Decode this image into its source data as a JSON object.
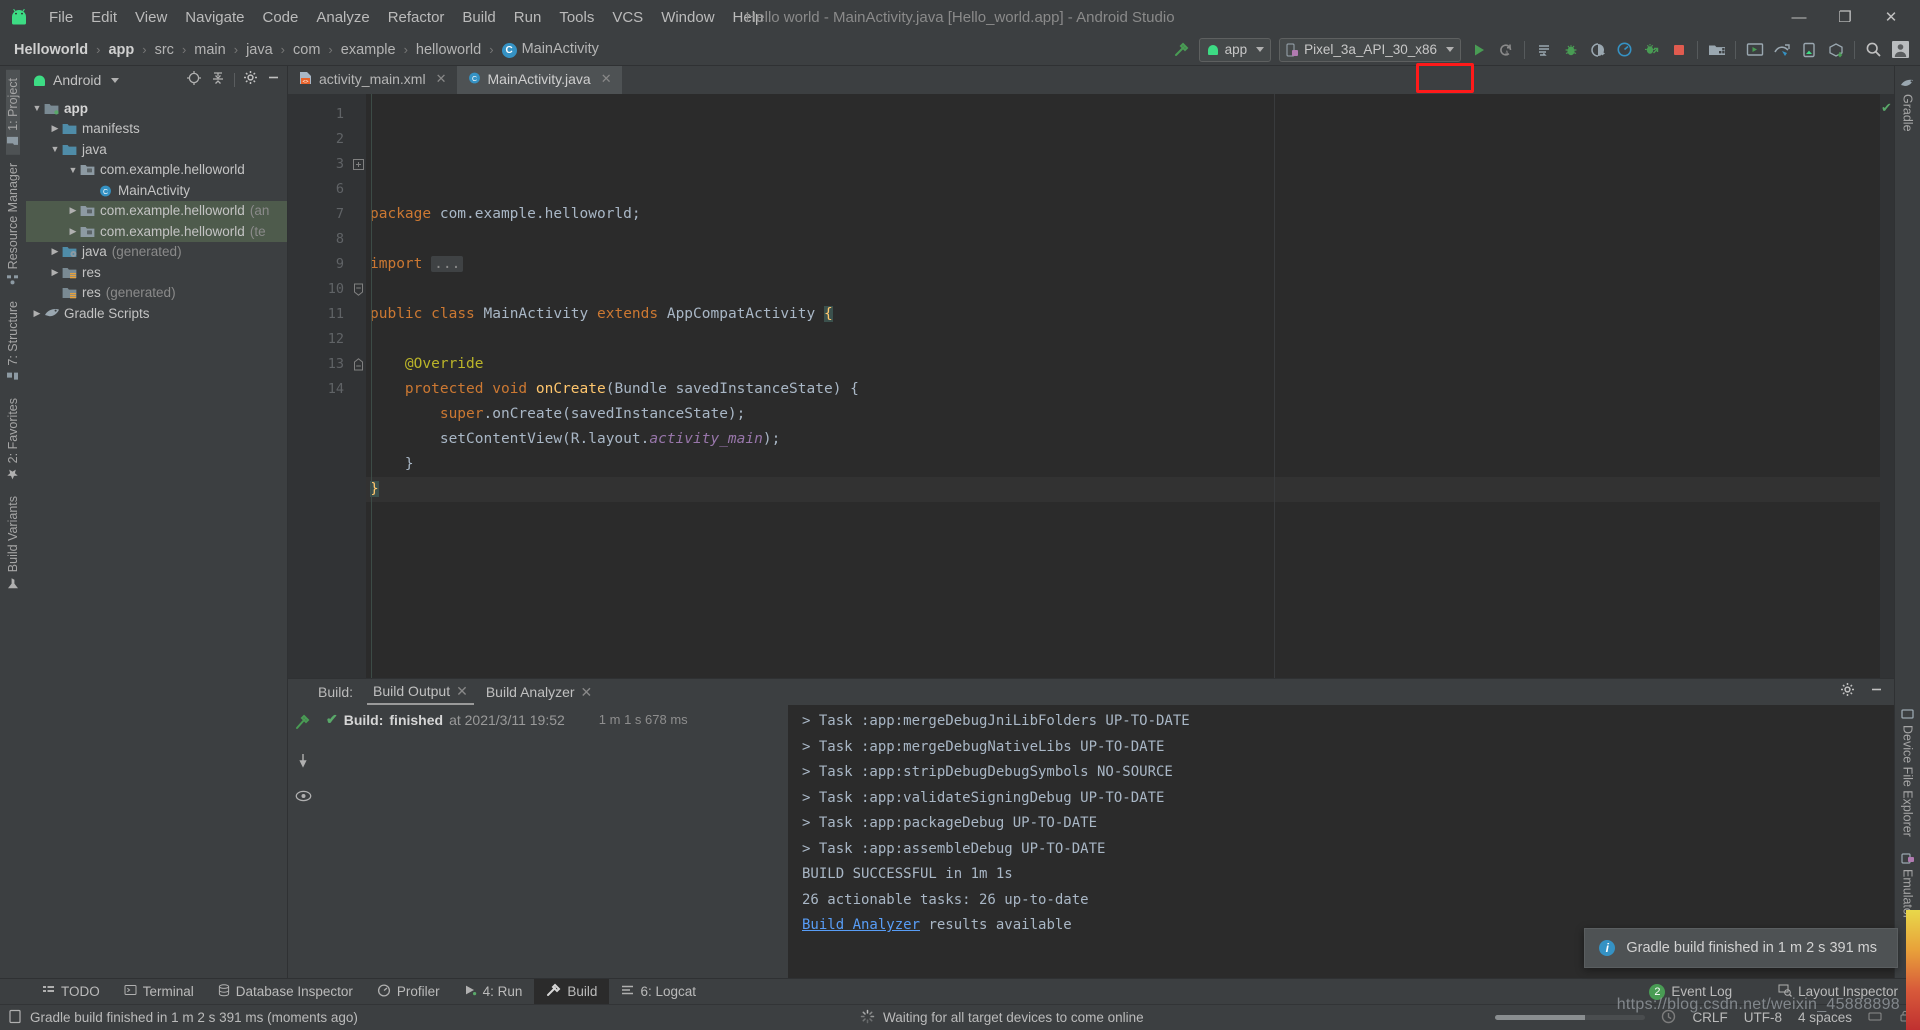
{
  "window": {
    "title": "Hello world - MainActivity.java [Hello_world.app] - Android Studio",
    "minimize": "—",
    "maximize": "❐",
    "close": "✕"
  },
  "menubar": {
    "items": [
      {
        "label": "File"
      },
      {
        "label": "Edit"
      },
      {
        "label": "View"
      },
      {
        "label": "Navigate"
      },
      {
        "label": "Code"
      },
      {
        "label": "Analyze"
      },
      {
        "label": "Refactor"
      },
      {
        "label": "Build"
      },
      {
        "label": "Run"
      },
      {
        "label": "Tools"
      },
      {
        "label": "VCS"
      },
      {
        "label": "Window"
      },
      {
        "label": "Help"
      }
    ]
  },
  "breadcrumb": {
    "items": [
      "Helloworld",
      "app",
      "src",
      "main",
      "java",
      "com",
      "example",
      "helloworld"
    ],
    "final": "MainActivity",
    "final_icon": "C",
    "separator": "›"
  },
  "toolbar": {
    "module_selector": "app",
    "device_selector": "Pixel_3a_API_30_x86",
    "buttons": [
      {
        "name": "make-project",
        "title": "Make Project"
      },
      {
        "name": "run",
        "title": "Run 'app'"
      },
      {
        "name": "apply-changes",
        "title": "Apply Changes"
      },
      {
        "name": "run-with-coverage",
        "title": "Run with Coverage"
      },
      {
        "name": "debug",
        "title": "Debug 'app'"
      },
      {
        "name": "attach-debugger",
        "title": "Attach Debugger to Android Process"
      },
      {
        "name": "profiler",
        "title": "Profile 'app'"
      },
      {
        "name": "debug-apk",
        "title": "Debug APK"
      },
      {
        "name": "stop",
        "title": "Stop"
      },
      {
        "name": "sdk-manager",
        "title": "SDK Manager"
      },
      {
        "name": "avd-manager",
        "title": "AVD Manager"
      },
      {
        "name": "layout-inspector",
        "title": "Layout Inspector"
      },
      {
        "name": "device-manager",
        "title": "Device Manager"
      },
      {
        "name": "sync-gradle",
        "title": "Sync Project with Gradle Files"
      },
      {
        "name": "search-everywhere",
        "title": "Search Everywhere"
      },
      {
        "name": "account",
        "title": "Account"
      }
    ]
  },
  "left_strip": {
    "items": [
      {
        "label": "1: Project",
        "active": true
      },
      {
        "label": "Resource Manager",
        "active": false
      },
      {
        "label": "7: Structure",
        "active": false
      },
      {
        "label": "2: Favorites",
        "active": false
      },
      {
        "label": "Build Variants",
        "active": false
      }
    ]
  },
  "right_strip": {
    "items": [
      {
        "label": "Gradle"
      },
      {
        "label": "Device File Explorer"
      },
      {
        "label": "Emulator"
      }
    ]
  },
  "project_panel": {
    "view_selector": "Android",
    "tree": [
      {
        "indent": 0,
        "arrow": "▼",
        "label": "app",
        "icon": "module-folder",
        "bold": true,
        "dim": "",
        "selected": false
      },
      {
        "indent": 1,
        "arrow": "▶",
        "label": "manifests",
        "icon": "folder",
        "bold": false,
        "dim": "",
        "selected": false
      },
      {
        "indent": 1,
        "arrow": "▼",
        "label": "java",
        "icon": "folder",
        "bold": false,
        "dim": "",
        "selected": false
      },
      {
        "indent": 2,
        "arrow": "▼",
        "label": "com.example.helloworld",
        "icon": "package",
        "bold": false,
        "dim": "",
        "selected": false
      },
      {
        "indent": 3,
        "arrow": "",
        "label": "MainActivity",
        "icon": "class",
        "bold": false,
        "dim": "",
        "selected": false
      },
      {
        "indent": 2,
        "arrow": "▶",
        "label": "com.example.helloworld",
        "icon": "package",
        "bold": false,
        "dim": "(an",
        "selected": true
      },
      {
        "indent": 2,
        "arrow": "▶",
        "label": "com.example.helloworld",
        "icon": "package",
        "bold": false,
        "dim": "(te",
        "selected": true
      },
      {
        "indent": 1,
        "arrow": "▶",
        "label": "java",
        "icon": "folder-gen",
        "bold": false,
        "dim": "(generated)",
        "selected": false
      },
      {
        "indent": 1,
        "arrow": "▶",
        "label": "res",
        "icon": "folder-res",
        "bold": false,
        "dim": "",
        "selected": false
      },
      {
        "indent": 1,
        "arrow": "",
        "label": "res",
        "icon": "folder-res",
        "bold": false,
        "dim": "(generated)",
        "selected": false
      },
      {
        "indent": 0,
        "arrow": "▶",
        "label": "Gradle Scripts",
        "icon": "gradle",
        "bold": false,
        "dim": "",
        "selected": false
      }
    ]
  },
  "editor": {
    "tabs": [
      {
        "label": "activity_main.xml",
        "icon": "xml-layout-icon",
        "active": false,
        "close": "✕"
      },
      {
        "label": "MainActivity.java",
        "icon": "java-class-icon",
        "active": true,
        "close": "✕"
      }
    ],
    "line_numbers": [
      "1",
      "2",
      "3",
      "6",
      "7",
      "8",
      "9",
      "10",
      "11",
      "12",
      "13",
      "14"
    ],
    "lines": [
      "package com.example.helloworld;",
      "",
      "import ...",
      "",
      "public class MainActivity extends AppCompatActivity {",
      "",
      "    @Override",
      "    protected void onCreate(Bundle savedInstanceState) {",
      "        super.onCreate(savedInstanceState);",
      "        setContentView(R.layout.activity_main);",
      "    }",
      "}"
    ]
  },
  "build_panel": {
    "group_label": "Build:",
    "tabs": [
      {
        "label": "Build Output",
        "active": true,
        "close": "✕"
      },
      {
        "label": "Build Analyzer",
        "active": false,
        "close": "✕"
      }
    ],
    "tree_status_prefix": "Build:",
    "tree_status_bold": "finished",
    "tree_status_at": "at 2021/3/11 19:52",
    "tree_duration": "1 m 1 s 678 ms",
    "console": [
      "> Task :app:mergeDebugJniLibFolders UP-TO-DATE",
      "> Task :app:mergeDebugNativeLibs UP-TO-DATE",
      "> Task :app:stripDebugDebugSymbols NO-SOURCE",
      "> Task :app:validateSigningDebug UP-TO-DATE",
      "> Task :app:packageDebug UP-TO-DATE",
      "> Task :app:assembleDebug UP-TO-DATE",
      "",
      "BUILD SUCCESSFUL in 1m 1s",
      "26 actionable tasks: 26 up-to-date",
      ""
    ],
    "console_link": "Build Analyzer",
    "console_link_suffix": " results available"
  },
  "tool_windows": {
    "left": [
      {
        "label": "TODO",
        "icon": "todo-icon",
        "active": false
      },
      {
        "label": "Terminal",
        "icon": "terminal-icon",
        "active": false
      },
      {
        "label": "Database Inspector",
        "icon": "database-icon",
        "active": false
      },
      {
        "label": "Profiler",
        "icon": "profiler-icon",
        "active": false
      },
      {
        "label": "4: Run",
        "icon": "run-icon",
        "active": false
      },
      {
        "label": "Build",
        "icon": "build-hammer-icon",
        "active": true
      },
      {
        "label": "6: Logcat",
        "icon": "logcat-icon",
        "active": false
      }
    ],
    "right": [
      {
        "label": "Event Log",
        "icon": "event-log-icon",
        "badge": "2"
      },
      {
        "label": "Layout Inspector",
        "icon": "layout-inspector-icon",
        "badge": ""
      }
    ]
  },
  "status_bar": {
    "message": "Gradle build finished in 1 m 2 s 391 ms (moments ago)",
    "progress_message": "Waiting for all target devices to come online",
    "line_ending": "CRLF",
    "encoding": "UTF-8",
    "indent": "4 spaces"
  },
  "toast": {
    "icon": "info-icon",
    "message": "Gradle build finished in 1 m 2 s 391 ms"
  },
  "watermark": "https://blog.csdn.net/weixin_45888898",
  "colors": {
    "accent_green": "#59a869",
    "accent_blue": "#3592c4",
    "highlight_red": "#ff1a1a",
    "bg_chrome": "#3c3f41",
    "bg_editor": "#2b2b2b"
  }
}
